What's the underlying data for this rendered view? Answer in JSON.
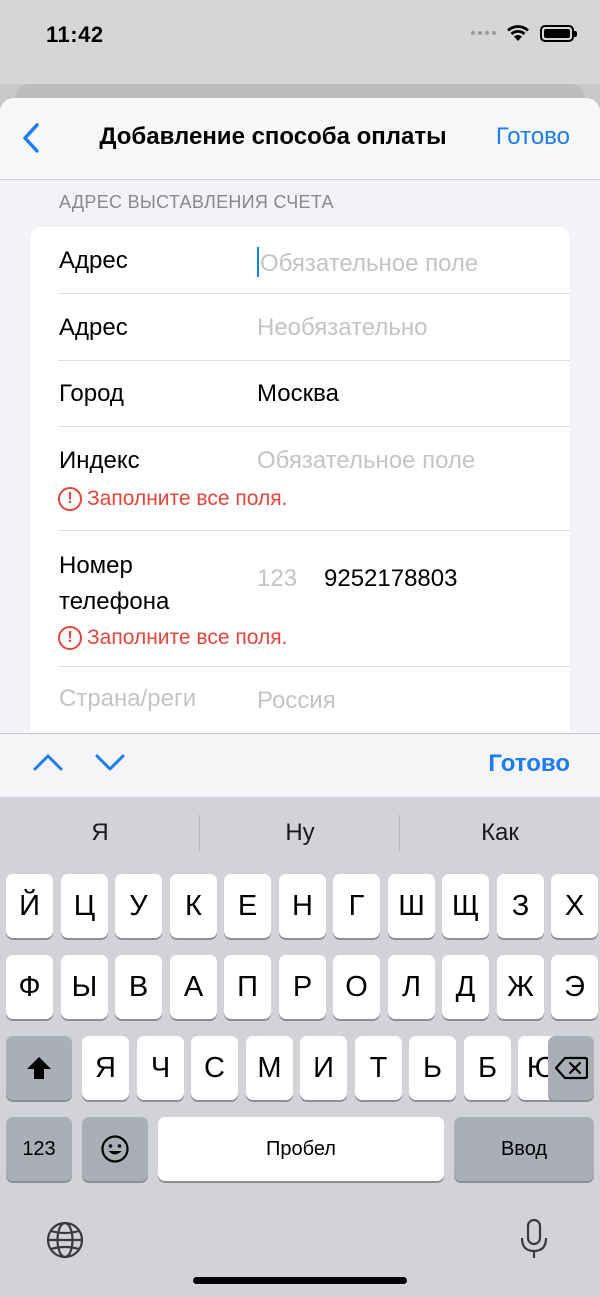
{
  "status": {
    "time": "11:42"
  },
  "nav": {
    "title": "Добавление способа оплаты",
    "done": "Готово"
  },
  "form": {
    "section_header": "АДРЕС ВЫСТАВЛЕНИЯ СЧЕТА",
    "address1": {
      "label": "Адрес",
      "placeholder": "Обязательное поле"
    },
    "address2": {
      "label": "Адрес",
      "placeholder": "Необязательно"
    },
    "city": {
      "label": "Город",
      "value": "Москва"
    },
    "zip": {
      "label": "Индекс",
      "placeholder": "Обязательное поле",
      "error": "Заполните все поля."
    },
    "phone": {
      "label_line1": "Номер",
      "label_line2": "телефона",
      "prefix_placeholder": "123",
      "value": "9252178803",
      "error": "Заполните все поля."
    },
    "country": {
      "label": "Страна/реги",
      "value": "Россия"
    }
  },
  "toolbar": {
    "done": "Готово"
  },
  "keyboard": {
    "suggestions": [
      "Я",
      "Ну",
      "Как"
    ],
    "row1": [
      "Й",
      "Ц",
      "У",
      "К",
      "Е",
      "Н",
      "Г",
      "Ш",
      "Щ",
      "З",
      "Х"
    ],
    "row2": [
      "Ф",
      "Ы",
      "В",
      "А",
      "П",
      "Р",
      "О",
      "Л",
      "Д",
      "Ж",
      "Э"
    ],
    "row3": [
      "Я",
      "Ч",
      "С",
      "М",
      "И",
      "Т",
      "Ь",
      "Б",
      "Ю"
    ],
    "numbers_key": "123",
    "space_key": "Пробел",
    "return_key": "Ввод"
  }
}
